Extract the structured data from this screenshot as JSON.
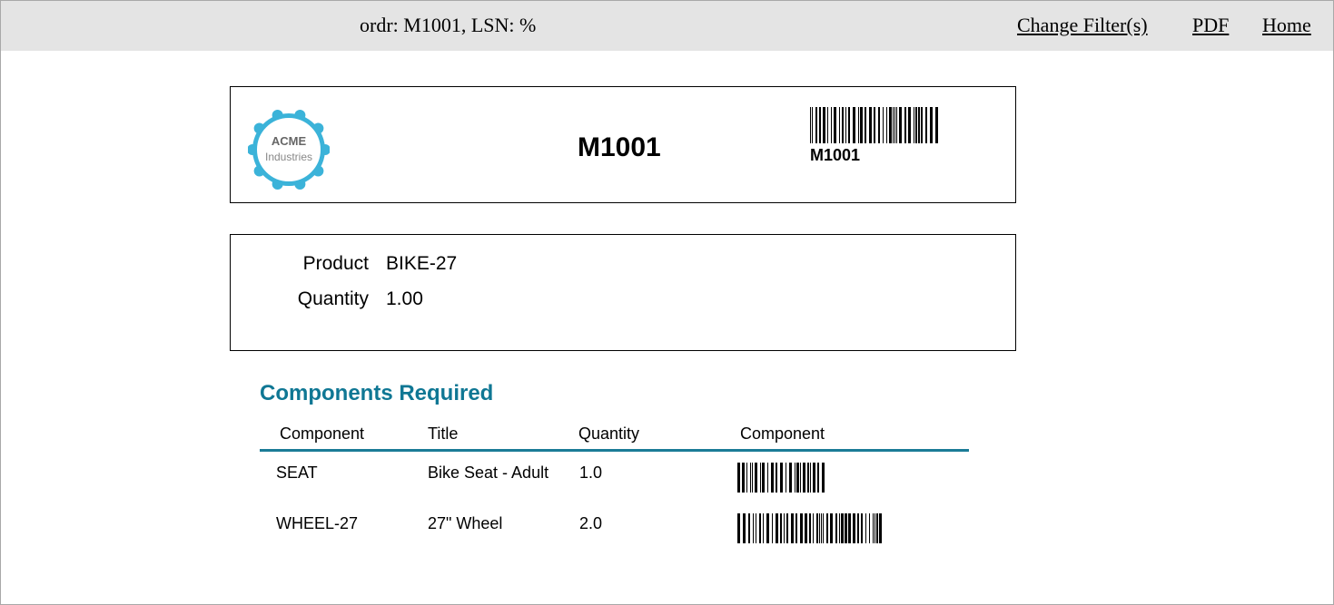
{
  "topbar": {
    "filter_text": "ordr: M1001, LSN: %",
    "links": {
      "change_filters": "Change Filter(s)",
      "pdf": "PDF",
      "home": "Home"
    }
  },
  "header": {
    "logo": {
      "line1": "ACME",
      "line2": "Industries",
      "color": "#3bb3d9"
    },
    "order_number": "M1001",
    "barcode_text": "M1001"
  },
  "details": {
    "product_label": "Product",
    "product_value": "BIKE-27",
    "quantity_label": "Quantity",
    "quantity_value": "1.00"
  },
  "components": {
    "title": "Components Required",
    "title_color": "#0f7794",
    "columns": [
      "Component",
      "Title",
      "Quantity",
      "Component"
    ],
    "rows": [
      {
        "component": "SEAT",
        "title": "Bike Seat - Adult",
        "quantity": "1.0"
      },
      {
        "component": "WHEEL-27",
        "title": "27\" Wheel",
        "quantity": "2.0"
      }
    ]
  }
}
